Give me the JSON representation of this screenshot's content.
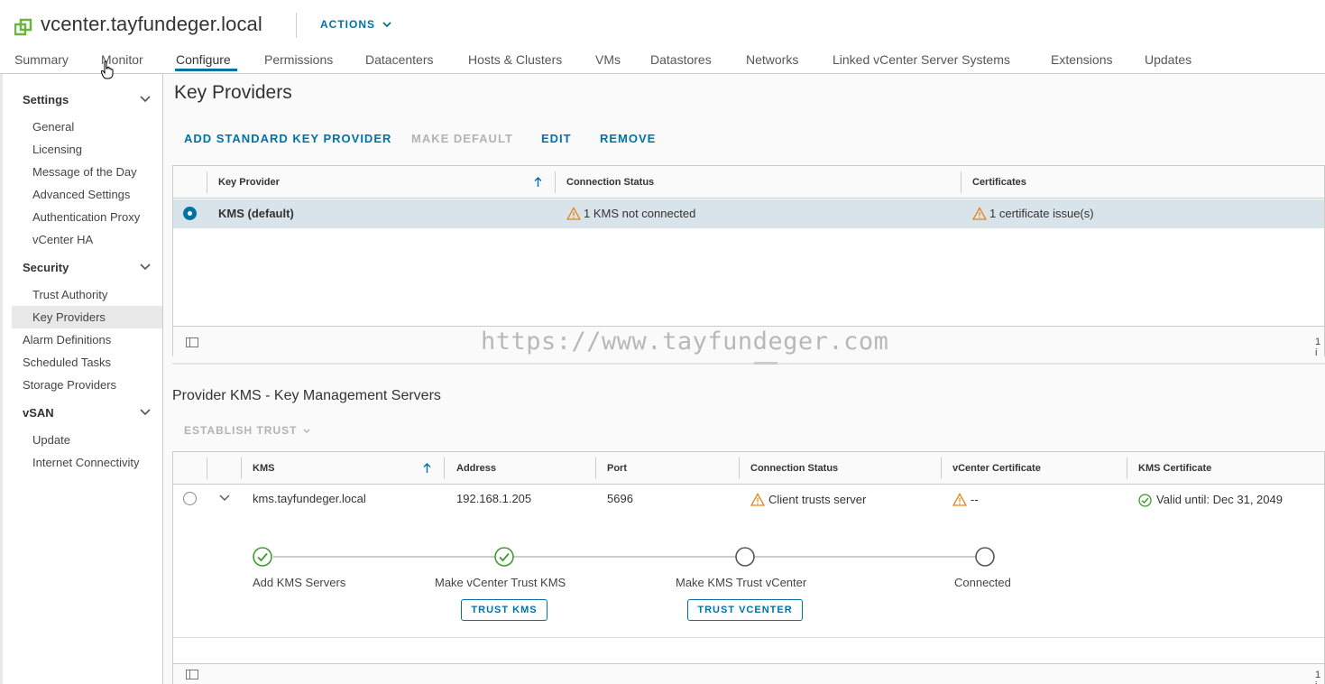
{
  "header": {
    "title": "vcenter.tayfundeger.local",
    "actions_label": "ACTIONS",
    "tabs": [
      "Summary",
      "Monitor",
      "Configure",
      "Permissions",
      "Datacenters",
      "Hosts & Clusters",
      "VMs",
      "Datastores",
      "Networks",
      "Linked vCenter Server Systems",
      "Extensions",
      "Updates"
    ],
    "active_tab": "Configure"
  },
  "sidebar": {
    "settings_label": "Settings",
    "settings_items": [
      "General",
      "Licensing",
      "Message of the Day",
      "Advanced Settings",
      "Authentication Proxy",
      "vCenter HA"
    ],
    "security_label": "Security",
    "security_items": [
      "Trust Authority",
      "Key Providers"
    ],
    "other_items": [
      "Alarm Definitions",
      "Scheduled Tasks",
      "Storage Providers"
    ],
    "vsan_label": "vSAN",
    "vsan_items": [
      "Update",
      "Internet Connectivity"
    ],
    "selected": "Key Providers"
  },
  "main": {
    "title": "Key Providers",
    "toolbar": {
      "add": "ADD STANDARD KEY PROVIDER",
      "make_default": "MAKE DEFAULT",
      "edit": "EDIT",
      "remove": "REMOVE"
    },
    "providers_table": {
      "columns": [
        "Key Provider",
        "Connection Status",
        "Certificates"
      ],
      "rows": [
        {
          "name": "KMS (default)",
          "status": "1 KMS not connected",
          "certs": "1 certificate issue(s)"
        }
      ],
      "footer_count": "1 i"
    },
    "watermark": "https://www.tayfundeger.com",
    "kms_section": {
      "title": "Provider KMS - Key Management Servers",
      "establish_trust": "ESTABLISH TRUST",
      "columns": [
        "KMS",
        "Address",
        "Port",
        "Connection Status",
        "vCenter Certificate",
        "KMS Certificate"
      ],
      "rows": [
        {
          "kms": "kms.tayfundeger.local",
          "address": "192.168.1.205",
          "port": "5696",
          "status": "Client trusts server",
          "vcenter_cert": "--",
          "kms_cert": "Valid until: Dec 31, 2049"
        }
      ],
      "steps": [
        {
          "label": "Add KMS Servers",
          "done": true
        },
        {
          "label": "Make vCenter Trust KMS",
          "done": true,
          "button": "TRUST KMS"
        },
        {
          "label": "Make KMS Trust vCenter",
          "done": false,
          "button": "TRUST VCENTER"
        },
        {
          "label": "Connected",
          "done": false
        }
      ],
      "footer_count": "1 i"
    }
  },
  "colors": {
    "accent": "#0072a3",
    "selected_row": "#d9e4ea",
    "warning": "#e0861b",
    "success": "#3d9a2e",
    "logo_green": "#6db33f"
  }
}
